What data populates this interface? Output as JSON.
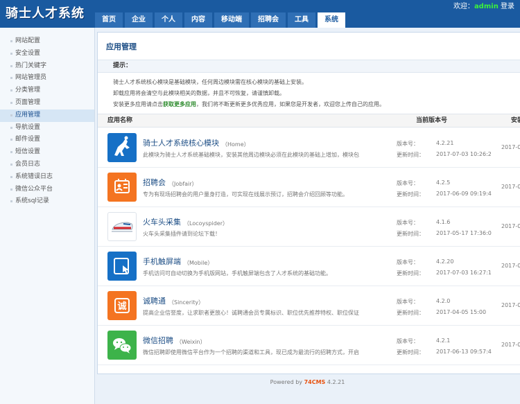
{
  "app": {
    "title": "骑士人才系统"
  },
  "userbar": {
    "welcome": "欢迎：",
    "username": "admin",
    "login": "登录"
  },
  "nav": [
    {
      "label": "首页"
    },
    {
      "label": "企业"
    },
    {
      "label": "个人"
    },
    {
      "label": "内容"
    },
    {
      "label": "移动端"
    },
    {
      "label": "招聘会"
    },
    {
      "label": "工具"
    },
    {
      "label": "系统",
      "active": true
    }
  ],
  "sidebar": [
    {
      "label": "网站配置"
    },
    {
      "label": "安全设置"
    },
    {
      "label": "热门关键字"
    },
    {
      "label": "网站管理员"
    },
    {
      "label": "分类管理"
    },
    {
      "label": "页面管理"
    },
    {
      "label": "应用管理",
      "active": true
    },
    {
      "label": "导航设置"
    },
    {
      "label": "邮件设置"
    },
    {
      "label": "短信设置"
    },
    {
      "label": "会员日志"
    },
    {
      "label": "系统错误日志"
    },
    {
      "label": "微信公众平台"
    },
    {
      "label": "系统sql记录"
    }
  ],
  "panel": {
    "title": "应用管理",
    "tips": {
      "heading": "提示：",
      "line1": "骑士人才系统核心模块是基础模块，任何周边模块需在核心模块的基础上安装。",
      "line2": "卸载应用将会清空与此模块相关的数据，并且不可恢复，请谨慎卸载。",
      "line3_pre": "安装更多应用请点击",
      "line3_link": "获取更多应用",
      "line3_post": "，我们将不断更新更多优秀应用，如果您是开发者，欢迎您上传自己的应用。"
    },
    "columns": {
      "name": "应用名称",
      "version": "当前版本号",
      "install": "安装时间"
    },
    "labels": {
      "version": "版本号：",
      "update": "更新时间："
    }
  },
  "apps": [
    {
      "name": "骑士人才系统核心模块",
      "code": "（Home）",
      "desc": "此模块为骑士人才系统基础模块，安装其他周边模块必须在此模块的基础上增加，模块包",
      "version": "4.2.21",
      "updated": "2017-07-03 10:26:2",
      "installed": "2017-0",
      "icon": "knight-icon",
      "color": "#1670c6"
    },
    {
      "name": "招聘会",
      "code": "（Jobfair）",
      "desc": "专为有现场招聘会的用户量身打造，可实现在线展示预订，招聘会介绍回顾等功能。",
      "version": "4.2.5",
      "updated": "2017-06-09 09:19:4",
      "installed": "2017-0",
      "icon": "jobfair-icon",
      "color": "#f47421"
    },
    {
      "name": "火车头采集",
      "code": "（Locoyspider）",
      "desc": "火车头采集插件请到论坛下载！",
      "version": "4.1.6",
      "updated": "2017-05-17 17:36:0",
      "installed": "2017-0",
      "icon": "train-icon",
      "color": "#ffffff"
    },
    {
      "name": "手机触屏端",
      "code": "（Mobile）",
      "desc": "手机访问可自动切换为手机版网站，手机触屏端包含了人才系统的基础功能。",
      "version": "4.2.20",
      "updated": "2017-07-03 16:27:1",
      "installed": "2017-0",
      "icon": "mobile-touch-icon",
      "color": "#1670c6"
    },
    {
      "name": "诚聘通",
      "code": "（Sincerity）",
      "desc": "提高企业信誉度，让求职者更放心！诚聘通会员专属标识、职位优先推荐特权、职位保证",
      "version": "4.2.0",
      "updated": "2017-04-05 15:00",
      "installed": "2017-0",
      "icon": "sincerity-icon",
      "color": "#f47421"
    },
    {
      "name": "微信招聘",
      "code": "（Weixin）",
      "desc": "微信招聘即使用微信平台作为一个招聘的渠道和工具，现已成为最流行的招聘方式，开启",
      "version": "4.2.1",
      "updated": "2017-06-13 09:57:4",
      "installed": "2017-0",
      "icon": "wechat-icon",
      "color": "#3db34a"
    }
  ],
  "footer": {
    "prefix": "Powered by",
    "brand": "74CMS",
    "version": "4.2.21"
  }
}
